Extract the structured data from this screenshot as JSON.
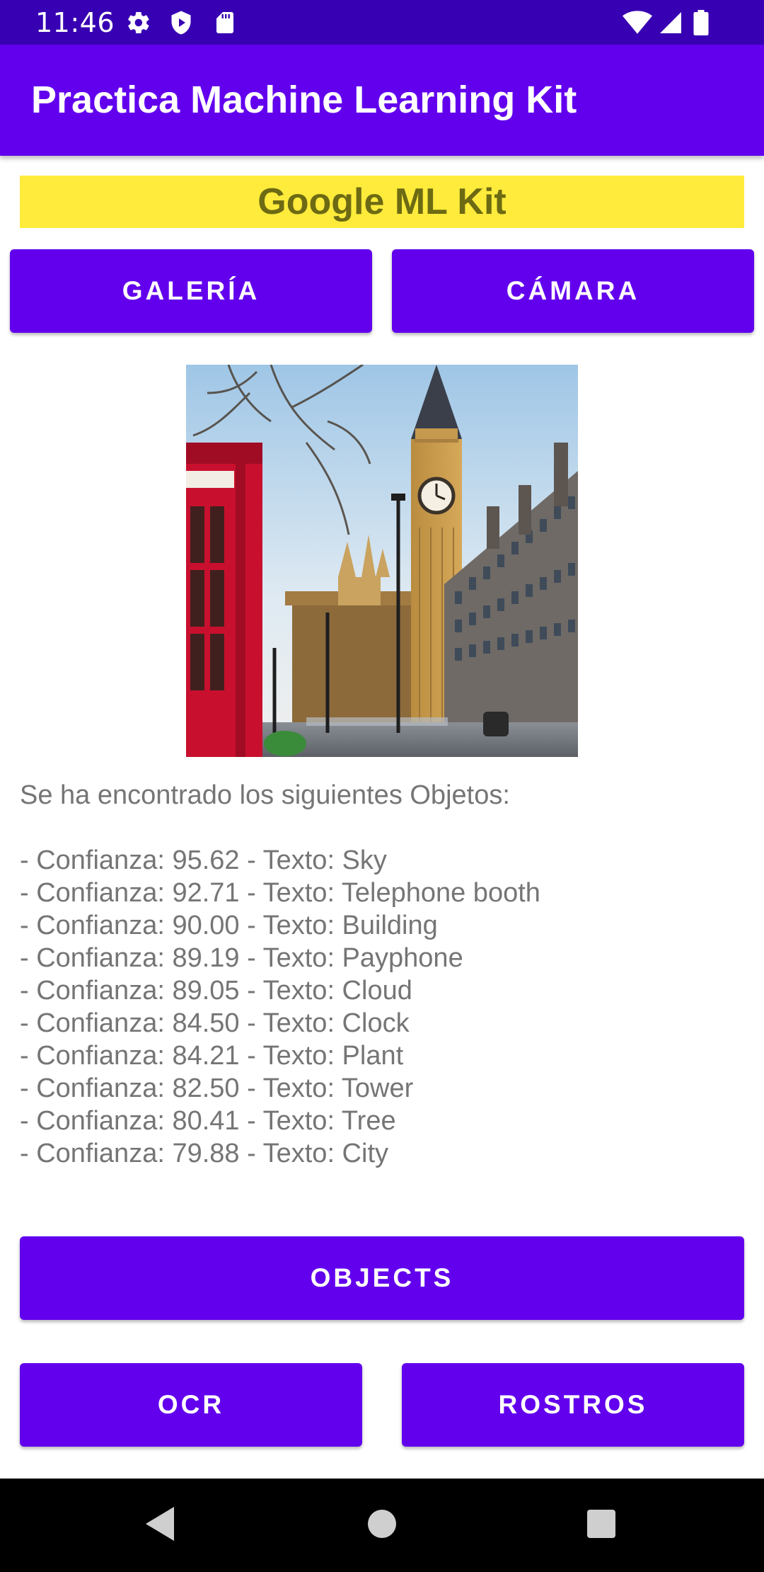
{
  "status_bar": {
    "time": "11:46",
    "left_icons": [
      "gear-icon",
      "shield-play-icon",
      "sd-card-icon"
    ],
    "right_icons": [
      "wifi-icon",
      "signal-icon",
      "battery-icon"
    ]
  },
  "app_bar": {
    "title": "Practica Machine Learning Kit"
  },
  "banner": {
    "text": "Google ML Kit"
  },
  "top_buttons": {
    "gallery": "GALERÍA",
    "camera": "CÁMARA"
  },
  "image": {
    "icon": "london-big-ben-photo"
  },
  "results": {
    "heading": "Se ha encontrado los siguientes Objetos:",
    "lines": [
      "- Confianza: 95.62 - Texto: Sky",
      "- Confianza: 92.71 - Texto: Telephone booth",
      "- Confianza: 90.00 - Texto: Building",
      "- Confianza: 89.19 - Texto: Payphone",
      "- Confianza: 89.05 - Texto: Cloud",
      "- Confianza: 84.50 - Texto: Clock",
      "- Confianza: 84.21 - Texto: Plant",
      "- Confianza: 82.50 - Texto: Tower",
      "- Confianza: 80.41 - Texto: Tree",
      "- Confianza: 79.88 - Texto: City"
    ]
  },
  "bottom_buttons": {
    "objects": "OBJECTS",
    "ocr": "OCR",
    "faces": "ROSTROS"
  },
  "nav_bar": {
    "icons": [
      "back-icon",
      "home-icon",
      "recents-icon"
    ]
  },
  "colors": {
    "status_bar": "#3700B3",
    "primary": "#6200EE",
    "banner": "#FFEB3B",
    "banner_text": "#6d6a14",
    "body_text": "#757575"
  }
}
